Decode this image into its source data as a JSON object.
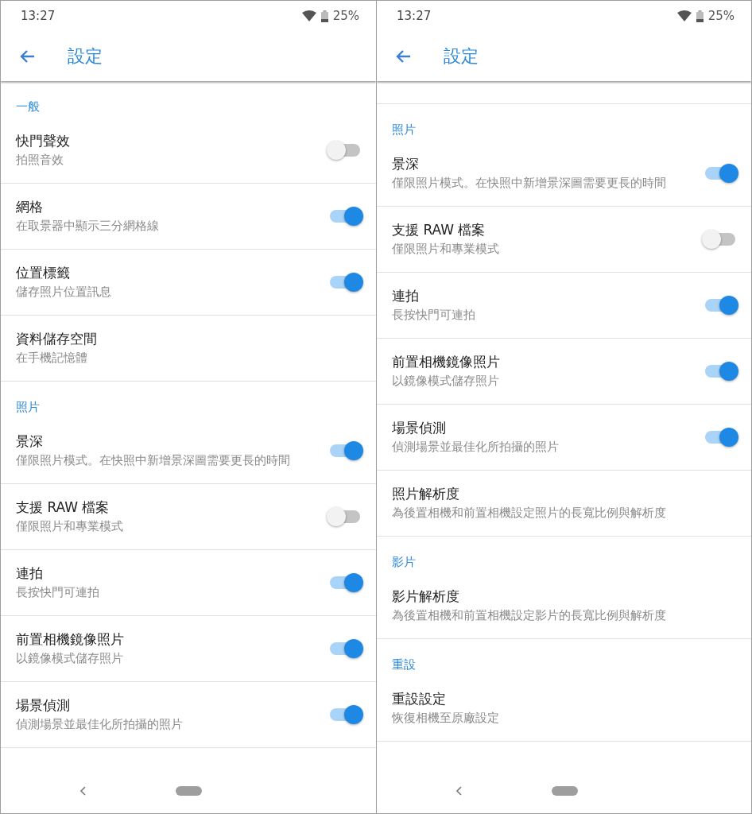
{
  "screens": [
    {
      "status_bar": {
        "time": "13:27",
        "battery": "25%"
      },
      "header": {
        "title": "設定"
      },
      "items": [
        {
          "kind": "section",
          "label": "一般"
        },
        {
          "kind": "setting",
          "title": "快門聲效",
          "subtitle": "拍照音效",
          "on": false
        },
        {
          "kind": "setting",
          "title": "網格",
          "subtitle": "在取景器中顯示三分網格線",
          "on": true
        },
        {
          "kind": "setting",
          "title": "位置標籤",
          "subtitle": "儲存照片位置訊息",
          "on": true
        },
        {
          "kind": "setting",
          "title": "資料儲存空間",
          "subtitle": "在手機記憶體"
        },
        {
          "kind": "section",
          "label": "照片"
        },
        {
          "kind": "setting",
          "title": "景深",
          "subtitle": "僅限照片模式。在快照中新增景深圖需要更長的時間",
          "on": true
        },
        {
          "kind": "setting",
          "title": "支援 RAW 檔案",
          "subtitle": "僅限照片和專業模式",
          "on": false
        },
        {
          "kind": "setting",
          "title": "連拍",
          "subtitle": "長按快門可連拍",
          "on": true
        },
        {
          "kind": "setting",
          "title": "前置相機鏡像照片",
          "subtitle": "以鏡像模式儲存照片",
          "on": true
        },
        {
          "kind": "setting",
          "title": "場景偵測",
          "subtitle": "偵測場景並最佳化所拍攝的照片",
          "on": true
        }
      ]
    },
    {
      "status_bar": {
        "time": "13:27",
        "battery": "25%"
      },
      "header": {
        "title": "設定"
      },
      "items": [
        {
          "kind": "cut_off"
        },
        {
          "kind": "section",
          "label": "照片"
        },
        {
          "kind": "setting",
          "title": "景深",
          "subtitle": "僅限照片模式。在快照中新增景深圖需要更長的時間",
          "on": true
        },
        {
          "kind": "setting",
          "title": "支援 RAW 檔案",
          "subtitle": "僅限照片和專業模式",
          "on": false
        },
        {
          "kind": "setting",
          "title": "連拍",
          "subtitle": "長按快門可連拍",
          "on": true
        },
        {
          "kind": "setting",
          "title": "前置相機鏡像照片",
          "subtitle": "以鏡像模式儲存照片",
          "on": true
        },
        {
          "kind": "setting",
          "title": "場景偵測",
          "subtitle": "偵測場景並最佳化所拍攝的照片",
          "on": true
        },
        {
          "kind": "setting",
          "title": "照片解析度",
          "subtitle": "為後置相機和前置相機設定照片的長寬比例與解析度"
        },
        {
          "kind": "section",
          "label": "影片"
        },
        {
          "kind": "setting",
          "title": "影片解析度",
          "subtitle": "為後置相機和前置相機設定影片的長寬比例與解析度"
        },
        {
          "kind": "section",
          "label": "重設"
        },
        {
          "kind": "setting",
          "title": "重設設定",
          "subtitle": "恢復相機至原廠設定"
        }
      ]
    }
  ]
}
